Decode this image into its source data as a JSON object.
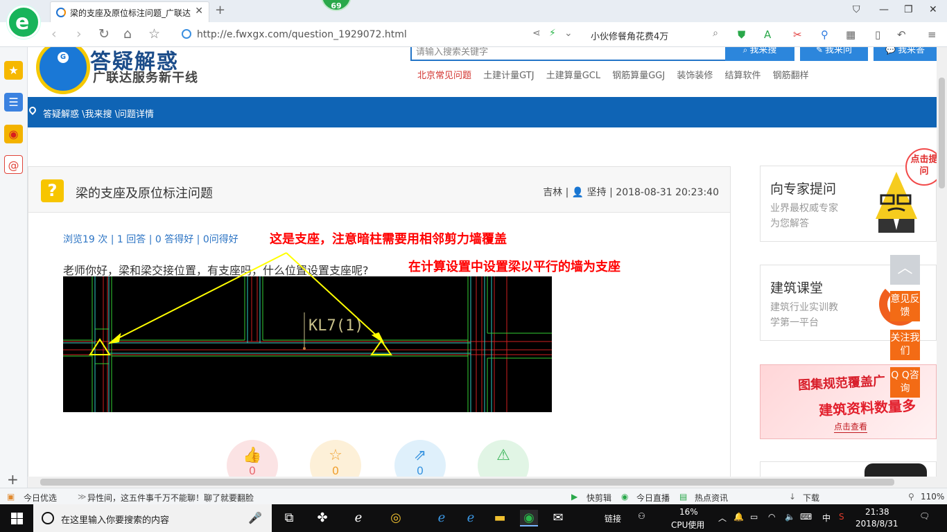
{
  "browser": {
    "tab_title": "梁的支座及原位标注问题_广联达",
    "notification_count": "69",
    "url": "http://e.fwxgx.com/question_1929072.html",
    "search_query": "小伙修餐角花费4万"
  },
  "site": {
    "logo_title": "答疑解惑",
    "logo_subtitle": "广联达服务新干线",
    "search_placeholder": "请输入搜索关键字",
    "search_button": "我来搜",
    "ask_button": "我来问",
    "answer_button": "我来答",
    "hot_links": [
      "北京常见问题",
      "土建计量GTJ",
      "土建算量GCL",
      "钢筋算量GGJ",
      "装饰装修",
      "结算软件",
      "钢筋翻样"
    ],
    "breadcrumb": "答疑解惑 \\我来搜 \\问题详情"
  },
  "question": {
    "title": "梁的支座及原位标注问题",
    "meta": "吉林 | 👤 坚持 | 2018-08-31 20:23:40",
    "stats": "浏览19 次 | 1 回答 | 0 答得好 | 0问得好",
    "body": "老师你好，梁和梁交接位置，有支座吗，什么位置设置支座呢?",
    "annotation_1": "这是支座，注意暗柱需要用相邻剪力墙覆盖",
    "annotation_2": "在计算设置中设置梁以平行的墙为支座",
    "drawing_label": "KL7(1)",
    "actions": [
      {
        "icon": "👍",
        "count": "0"
      },
      {
        "icon": "☆",
        "count": "0"
      },
      {
        "icon": "⇗",
        "count": "0"
      },
      {
        "icon": "⚠",
        "count": ""
      }
    ]
  },
  "sidebar_right": {
    "expert_title": "向专家提问",
    "expert_sub1": "业界最权威专家",
    "expert_sub2": "为您解答",
    "course_title": "建筑课堂",
    "course_sub1": "建筑行业实训教",
    "course_sub2": "学第一平台",
    "ad_line1": "图集规范覆盖广",
    "ad_line2": "建筑资料数量多",
    "ad_button": "点击查看",
    "float_ask": "点击提问",
    "feedback": "意见反馈",
    "follow": "关注我们",
    "qq": "Q Q咨询"
  },
  "status_bar": {
    "left1": "今日优选",
    "left2": "异性间，这五件事千万不能聊！聊了就要翻脸",
    "r1": "快剪辑",
    "r2": "今日直播",
    "r3": "热点资讯",
    "download": "下载",
    "zoom": "110%"
  },
  "taskbar": {
    "search_text": "在这里输入你要搜索的内容",
    "links": "链接",
    "cpu_percent": "16%",
    "cpu_label": "CPU使用",
    "ime": "中",
    "time": "21:38",
    "date": "2018/8/31"
  }
}
